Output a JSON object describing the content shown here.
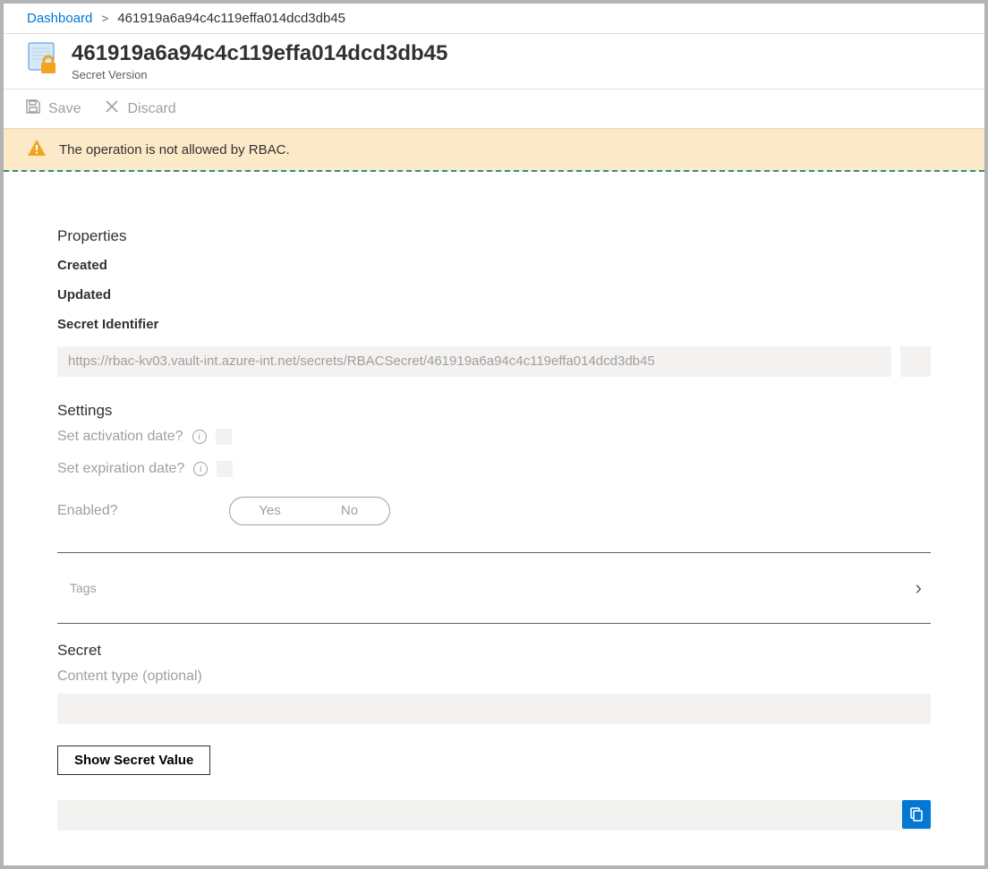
{
  "breadcrumb": {
    "root": "Dashboard",
    "current": "461919a6a94c4c119effa014dcd3db45"
  },
  "header": {
    "title": "461919a6a94c4c119effa014dcd3db45",
    "subtitle": "Secret Version"
  },
  "toolbar": {
    "save_label": "Save",
    "discard_label": "Discard"
  },
  "banner": {
    "message": "The operation is not allowed by RBAC."
  },
  "sections": {
    "properties_title": "Properties",
    "created_label": "Created",
    "updated_label": "Updated",
    "secret_identifier_label": "Secret Identifier",
    "secret_identifier_value": "https://rbac-kv03.vault-int.azure-int.net/secrets/RBACSecret/461919a6a94c4c119effa014dcd3db45",
    "settings_title": "Settings",
    "set_activation_label": "Set activation date?",
    "set_expiration_label": "Set expiration date?",
    "enabled_label": "Enabled?",
    "enabled_yes": "Yes",
    "enabled_no": "No",
    "tags_label": "Tags",
    "secret_title": "Secret",
    "content_type_label": "Content type (optional)",
    "show_secret_button": "Show Secret Value"
  }
}
